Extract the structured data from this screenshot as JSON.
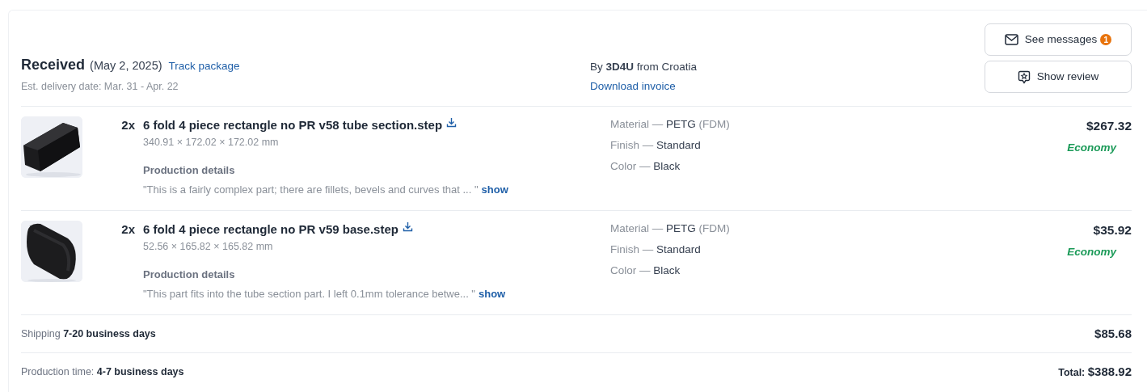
{
  "header": {
    "status": "Received",
    "date": "(May 2, 2025)",
    "track_link": "Track package",
    "estimate": "Est. delivery date: Mar. 31 - Apr. 22",
    "seller": "By **3D4U** from Croatia",
    "invoice_link": "Download invoice",
    "buttons": [
      {
        "kind": "messages",
        "label": "See messages",
        "badge": "1"
      },
      {
        "kind": "review",
        "label": "Show review"
      }
    ]
  },
  "items": [
    {
      "qty": "2x",
      "name": "6 fold 4 piece rectangle no PR v58 tube section.step",
      "dimensions": "340.91 × 172.02 × 172.02 mm",
      "details_label": "Production details",
      "details_text": "\"This is a fairly complex part; there are fillets, bevels and curves that ... \"",
      "show_link": "show",
      "specs": [
        {
          "label": "Material — ",
          "value": "PETG",
          "note": " (FDM)"
        },
        {
          "label": "Finish — ",
          "value": "Standard"
        },
        {
          "label": "Color — ",
          "value": "Black"
        }
      ],
      "price": "$267.32",
      "tier": "Economy"
    },
    {
      "qty": "2x",
      "name": "6 fold 4 piece rectangle no PR v59 base.step",
      "dimensions": "52.56 × 165.82 × 165.82 mm",
      "details_label": "Production details",
      "details_text": "\"This part fits into the tube section part. I left 0.1mm tolerance betwe... \"",
      "show_link": "show",
      "specs": [
        {
          "label": "Material — ",
          "value": "PETG",
          "note": " (FDM)"
        },
        {
          "label": "Finish — ",
          "value": "Standard"
        },
        {
          "label": "Color — ",
          "value": "Black"
        }
      ],
      "price": "$35.92",
      "tier": "Economy"
    }
  ],
  "summary": [
    {
      "label": "Shipping ",
      "value": "7-20 business days",
      "amount": "$85.68"
    },
    {
      "label": "Production time: ",
      "value": "4-7 business days",
      "amount_label": "Total: ",
      "amount": "$388.92"
    }
  ]
}
